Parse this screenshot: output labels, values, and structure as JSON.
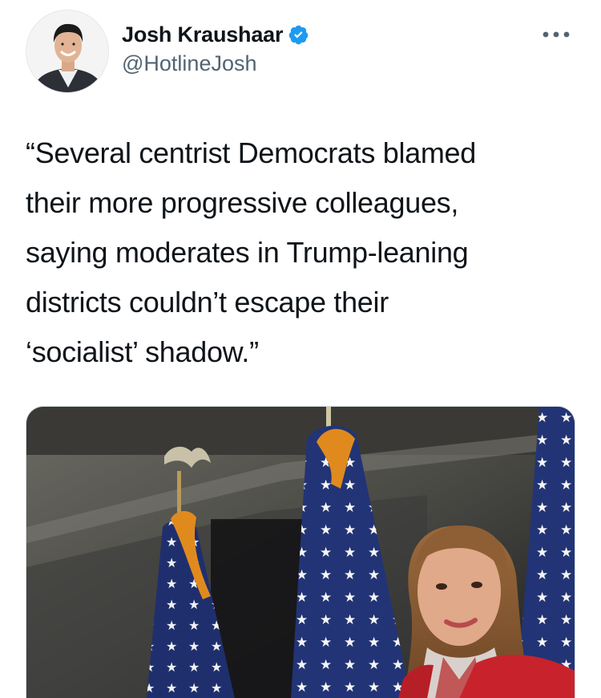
{
  "tweet": {
    "author": {
      "display_name": "Josh Kraushaar",
      "handle": "@HotlineJosh",
      "verified": true,
      "avatar_icon": "profile-photo"
    },
    "more_icon": "more-horizontal-icon",
    "text_lines": [
      "“Several centrist Democrats blamed",
      "their more progressive colleagues,",
      "saying moderates in Trump-leaning",
      "districts couldn’t escape their",
      "‘socialist’ shadow.”"
    ],
    "media": {
      "kind": "photo"
    }
  },
  "colors": {
    "verified_blue": "#1d9bf0",
    "text_primary": "#0f1419",
    "text_secondary": "#536471",
    "flag_blue": "#1f2f6e",
    "gold_fringe": "#e08a1e",
    "jacket_red": "#c8232c"
  }
}
